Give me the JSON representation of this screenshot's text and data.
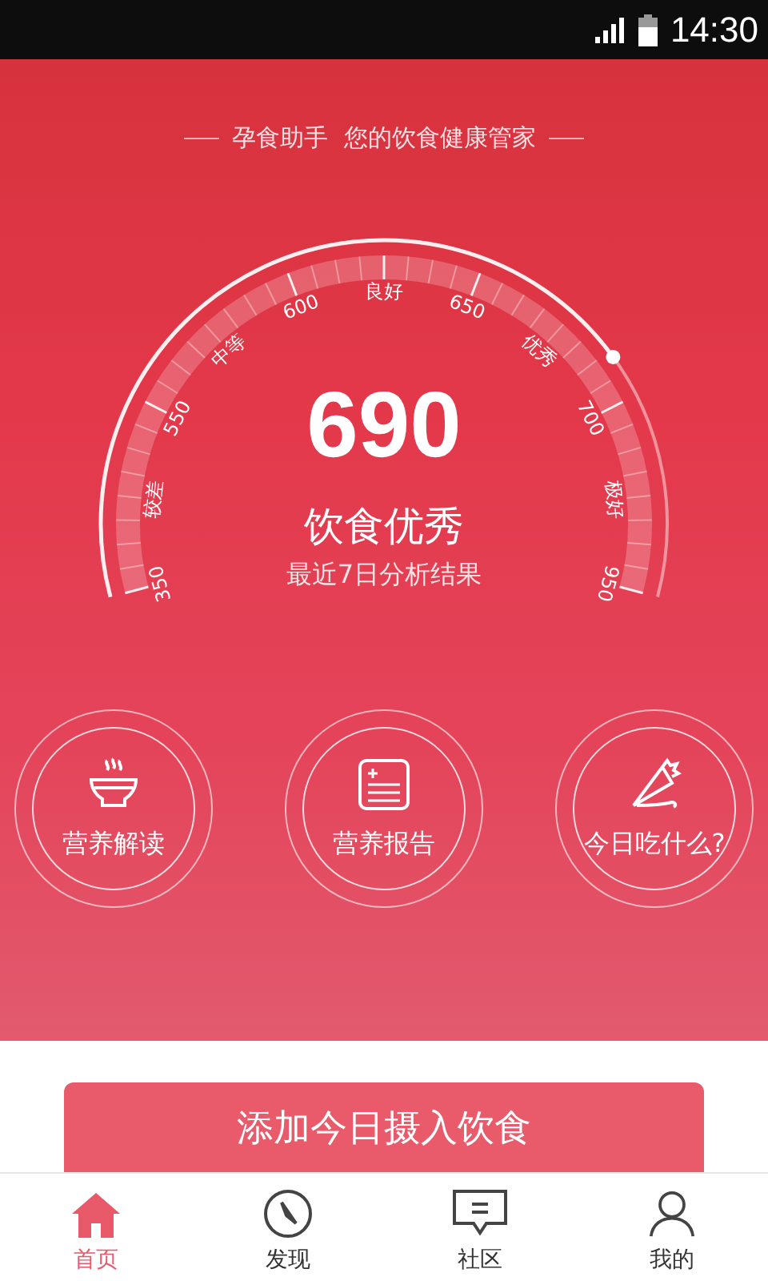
{
  "status_bar": {
    "time": "14:30"
  },
  "header": {
    "subtitle": "孕食助手  您的饮食健康管家"
  },
  "gauge": {
    "score": "690",
    "rating": "饮食优秀",
    "caption": "最近7日分析结果",
    "labels": [
      "350",
      "较差",
      "550",
      "中等",
      "600",
      "良好",
      "650",
      "优秀",
      "700",
      "极好",
      "950"
    ]
  },
  "features": [
    {
      "kind": "bowl",
      "label": "营养解读"
    },
    {
      "kind": "report",
      "label": "营养报告"
    },
    {
      "kind": "piping",
      "label": "今日吃什么?"
    }
  ],
  "add_button": {
    "label": "添加今日摄入饮食"
  },
  "nav": [
    {
      "kind": "home",
      "label": "首页",
      "selected": true
    },
    {
      "kind": "compass",
      "label": "发现",
      "selected": false
    },
    {
      "kind": "chat",
      "label": "社区",
      "selected": false
    },
    {
      "kind": "person",
      "label": "我的",
      "selected": false
    }
  ]
}
